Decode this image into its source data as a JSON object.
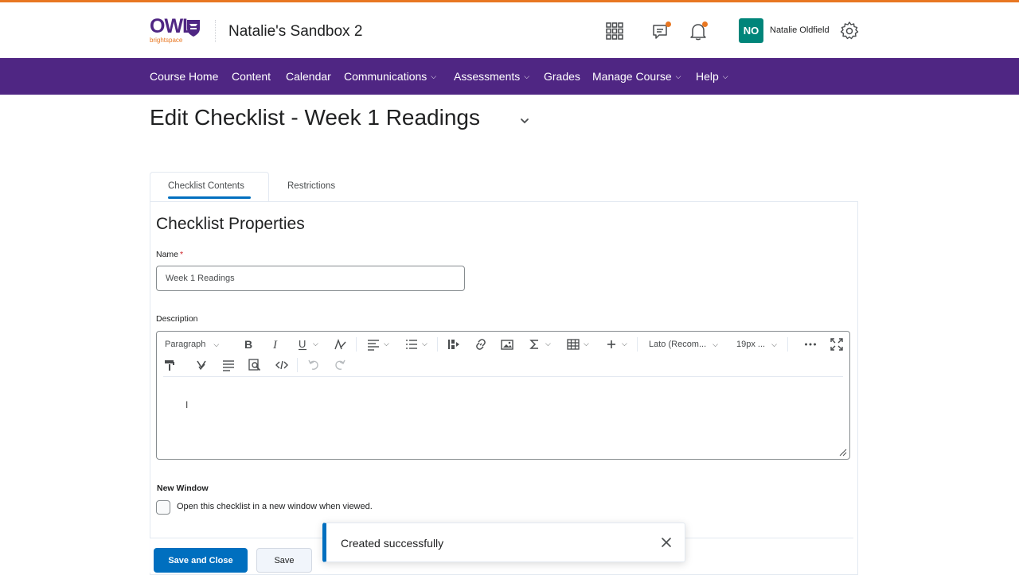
{
  "header": {
    "logo_text": "OWL",
    "logo_sub": "brightspace",
    "course_title": "Natalie's Sandbox 2",
    "avatar_initials": "NO",
    "user_name": "Natalie Oldfield",
    "icons": [
      "apps-grid-icon",
      "message-alerts-icon",
      "bell-icon",
      "gear-icon"
    ],
    "accent_color": "#4f2683",
    "notify_color": "#e87722"
  },
  "nav": {
    "items": [
      {
        "label": "Course Home"
      },
      {
        "label": "Content"
      },
      {
        "label": "Calendar"
      },
      {
        "label": "Communications"
      },
      {
        "label": "Assessments"
      },
      {
        "label": "Grades"
      },
      {
        "label": "Manage Course"
      },
      {
        "label": "Help"
      }
    ]
  },
  "page": {
    "title": "Edit Checklist - Week 1 Readings",
    "tabs": [
      {
        "label": "Checklist Contents",
        "active": true
      },
      {
        "label": "Restrictions",
        "active": false
      }
    ]
  },
  "form": {
    "section_title": "Checklist Properties",
    "name_label": "Name",
    "name_required": "*",
    "name_value": "Week 1 Readings",
    "description_label": "Description",
    "editor": {
      "block_format": "Paragraph",
      "font_family": "Lato (Recom...",
      "font_size": "19px ..."
    },
    "new_window_label": "New Window",
    "new_window_checkbox": "Open this checklist in a new window when viewed.",
    "new_window_checked": false
  },
  "footer": {
    "save_close_label": "Save and Close",
    "save_label": "Save"
  },
  "toast": {
    "message": "Created successfully"
  }
}
